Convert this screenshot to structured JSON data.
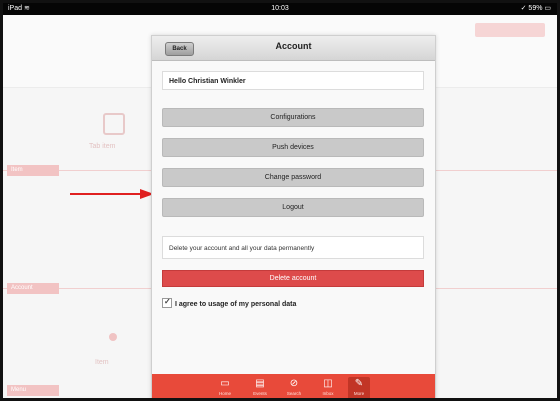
{
  "statusbar": {
    "left": "iPad ≋",
    "time": "10:03",
    "right": "✓ 59% ▭"
  },
  "background": {
    "items": [
      {
        "label": "Tab item"
      },
      {
        "label": "Item"
      }
    ],
    "tabs": [
      "Item",
      "Account",
      "Menu"
    ]
  },
  "panel": {
    "back_label": "Back",
    "title": "Account",
    "greeting": "Hello Christian Winkler",
    "buttons": {
      "configurations": "Configurations",
      "push_devices": "Push devices",
      "change_password": "Change password",
      "logout": "Logout"
    },
    "delete_info": "Delete your account and all your data permanently",
    "delete_button": "Delete account",
    "agree_label": "I agree to usage of my personal data",
    "agree_checked": true
  },
  "tabbar": {
    "items": [
      {
        "icon": "monitor-icon",
        "label": "Home"
      },
      {
        "icon": "list-icon",
        "label": "Events"
      },
      {
        "icon": "search-icon",
        "label": "Search"
      },
      {
        "icon": "tray-icon",
        "label": "Inbox"
      },
      {
        "icon": "tools-icon",
        "label": "More",
        "active": true
      }
    ]
  },
  "colors": {
    "accent": "#e84a3a",
    "delete": "#dd4b4b",
    "arrow": "#e02020"
  }
}
